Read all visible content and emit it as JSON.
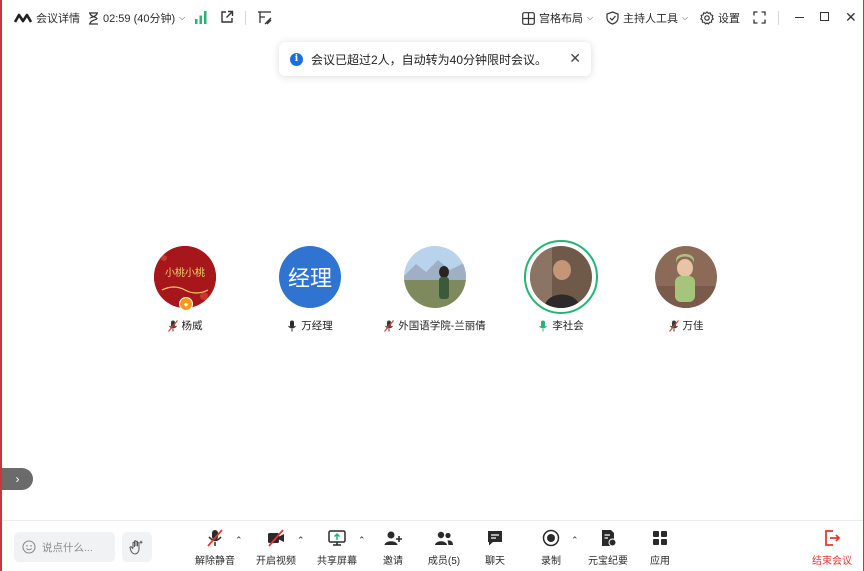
{
  "topbar": {
    "meeting_details_label": "会议详情",
    "timer_text": "02:59 (40分钟)",
    "layout_label": "宫格布局",
    "host_tools_label": "主持人工具",
    "settings_label": "设置"
  },
  "toast": {
    "message": "会议已超过2人，自动转为40分钟限时会议。"
  },
  "participants": [
    {
      "name": "杨威",
      "mic": "muted"
    },
    {
      "name": "万经理",
      "mic": "on",
      "initials": "经理"
    },
    {
      "name": "外国语学院-兰丽倩",
      "mic": "muted"
    },
    {
      "name": "李社会",
      "mic": "speaking"
    },
    {
      "name": "万佳",
      "mic": "muted"
    }
  ],
  "avatar1_text": "小桃小桃",
  "bottombar": {
    "chat_placeholder": "说点什么...",
    "unmute_label": "解除静音",
    "start_video_label": "开启视频",
    "share_screen_label": "共享屏幕",
    "invite_label": "邀请",
    "members_label": "成员(5)",
    "chat_label": "聊天",
    "record_label": "录制",
    "yuanbao_label": "元宝纪要",
    "apps_label": "应用",
    "end_label": "结束会议"
  },
  "colors": {
    "accent_blue": "#1a6fe0",
    "speaking_green": "#22b573",
    "end_red": "#e23a2e",
    "host_badge": "#f29a1a"
  }
}
